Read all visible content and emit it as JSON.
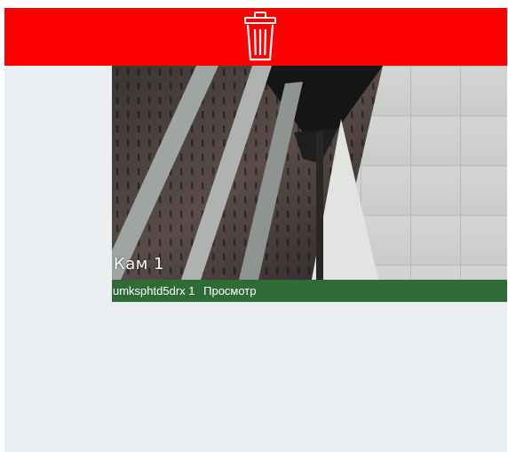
{
  "header": {
    "action_icon": "trash-can-icon",
    "color": "#ff0000"
  },
  "camera": {
    "label": "Кам 1",
    "device": "umksphtd5drx 1",
    "mode": "Просмотр",
    "status_color": "#2f6b36"
  }
}
